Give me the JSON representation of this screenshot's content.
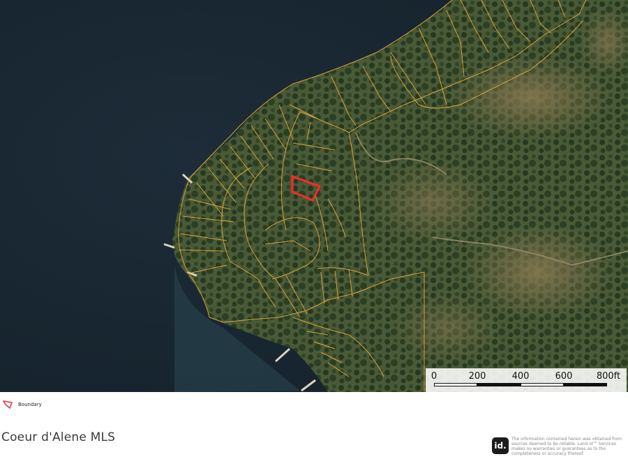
{
  "map": {
    "water_color": "#1b2a36",
    "land_color": "#4b5d3a",
    "parcel_line_color": "#d7a23c",
    "subject_parcel_color": "#ff2a2a",
    "map_type": "aerial satellite parcel map"
  },
  "scale_bar": {
    "labels": [
      "0",
      "200",
      "400",
      "600",
      "800ft"
    ]
  },
  "legend": {
    "icon": "boundary-polygon-icon",
    "label": "Boundary"
  },
  "footer": {
    "title": "Coeur d'Alene MLS",
    "logo_text": "id.",
    "disclaimer": "The information contained herein was obtained from sources deemed to be reliable. Land id™ Services makes no warranties or guarantees as to the completeness or accuracy thereof."
  }
}
